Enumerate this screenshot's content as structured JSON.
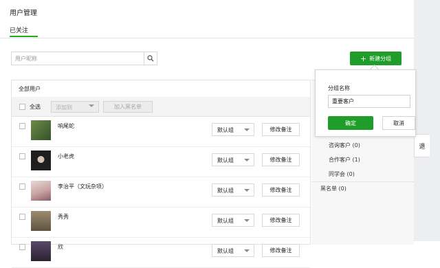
{
  "header": {
    "title": "用户管理",
    "tab_followed": "已关注"
  },
  "search": {
    "placeholder": "用户昵称"
  },
  "toolbar": {
    "new_group_label": "新建分组",
    "list_header": "全部用户",
    "select_all_label": "全选",
    "add_to_label": "添加到",
    "add_blacklist_label": "加入黑名单"
  },
  "users": [
    {
      "nickname": "响尾蛇",
      "group": "默认组",
      "remark_label": "修改备注",
      "avatar_color": "#5a7a3a"
    },
    {
      "nickname": "小老虎",
      "group": "默认组",
      "remark_label": "修改备注",
      "avatar_color": "#2b2b2b"
    },
    {
      "nickname": "李治平（文玩杂项）",
      "group": "默认组",
      "remark_label": "修改备注",
      "avatar_color": "#c7b0b0"
    },
    {
      "nickname": "秀秀",
      "group": "默认组",
      "remark_label": "修改备注",
      "avatar_color": "#7a6a55"
    },
    {
      "nickname": "欣",
      "group": "默认组",
      "remark_label": "修改备注",
      "avatar_color": "#3a3040"
    }
  ],
  "side_groups": [
    {
      "label": "咨询客户 (0)"
    },
    {
      "label": "合作客户 (1)"
    },
    {
      "label": "同学会 (0)"
    }
  ],
  "side_blacklist": "黑名单 (0)",
  "popover": {
    "label": "分组名称",
    "input_value": "重要客户",
    "confirm_label": "确定",
    "cancel_label": "取消"
  },
  "right_tab_label": "退",
  "colors": {
    "accent": "#1f9d2b",
    "tab_indicator": "#1aad19"
  }
}
